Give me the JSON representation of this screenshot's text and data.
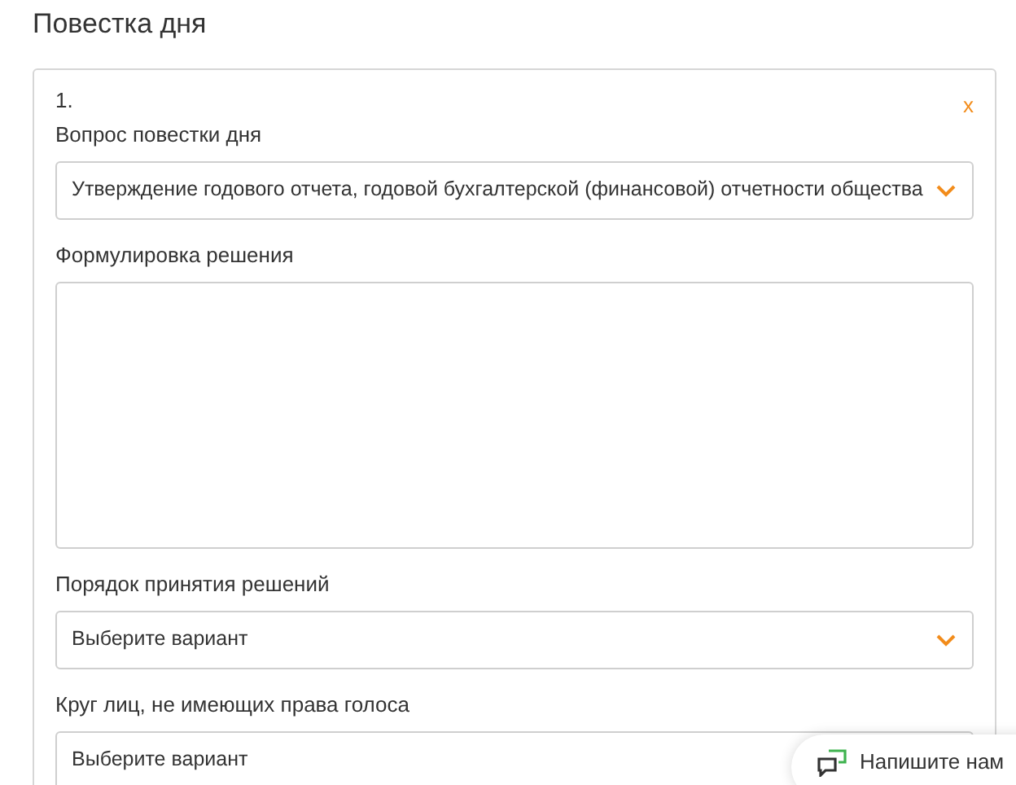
{
  "title": "Повестка дня",
  "items": [
    {
      "number": "1.",
      "remove": "x",
      "fields": [
        {
          "kind": "select",
          "label": "Вопрос повестки дня",
          "value": "Утверждение годового отчета, годовой бухгалтерской (финансовой) отчетности общества"
        },
        {
          "kind": "textarea",
          "label": "Формулировка решения"
        },
        {
          "kind": "select",
          "label": "Порядок принятия решений",
          "placeholder": "Выберите вариант"
        },
        {
          "kind": "select",
          "label": "Круг лиц, не имеющих права голоса",
          "placeholder": "Выберите вариант"
        }
      ]
    }
  ],
  "chat": {
    "label": "Напишите нам"
  }
}
